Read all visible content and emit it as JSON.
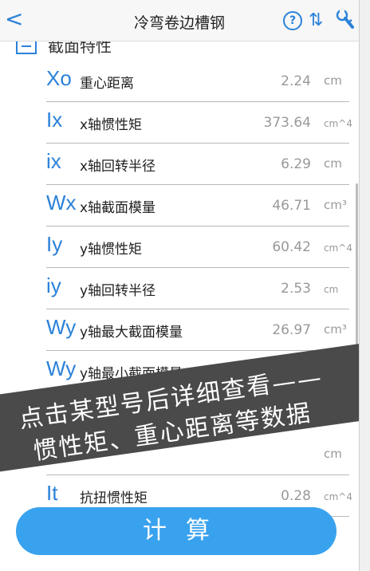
{
  "nav": {
    "back": "<",
    "title": "冷弯卷边槽钢",
    "help": "?",
    "sort": "⇅"
  },
  "section": {
    "label": "截面特性"
  },
  "rows": [
    {
      "sym": "Xo",
      "name": "重心距离",
      "value": "2.24",
      "unit": "cm"
    },
    {
      "sym": "Ix",
      "name": "x轴惯性矩",
      "value": "373.64",
      "unit": "cm^4"
    },
    {
      "sym": "ix",
      "name": "x轴回转半径",
      "value": "6.29",
      "unit": "cm"
    },
    {
      "sym": "Wx",
      "name": "x轴截面模量",
      "value": "46.71",
      "unit": "cm³"
    },
    {
      "sym": "Iy",
      "name": "y轴惯性矩",
      "value": "60.42",
      "unit": "cm^4"
    },
    {
      "sym": "iy",
      "name": "y轴回转半径",
      "value": "2.53",
      "unit": "cm"
    },
    {
      "sym": "Wy",
      "name": "y轴最大截面模量",
      "value": "26.97",
      "unit": "cm³"
    },
    {
      "sym": "Wy",
      "name": "y轴最小截面模量",
      "value": "",
      "unit": ""
    },
    {
      "sym": "",
      "name": "",
      "value": "",
      "unit": "cm"
    },
    {
      "sym": "It",
      "name": "抗扭惯性矩",
      "value": "0.28",
      "unit": "cm^4"
    }
  ],
  "banner": {
    "line1": "点击某型号后详细查看——",
    "line2": "惯性矩、重心距离等数据"
  },
  "calc_button": "计算",
  "colors": {
    "accent": "#2b82d9",
    "button": "#39a2ee",
    "banner": "#4a4a4a"
  }
}
